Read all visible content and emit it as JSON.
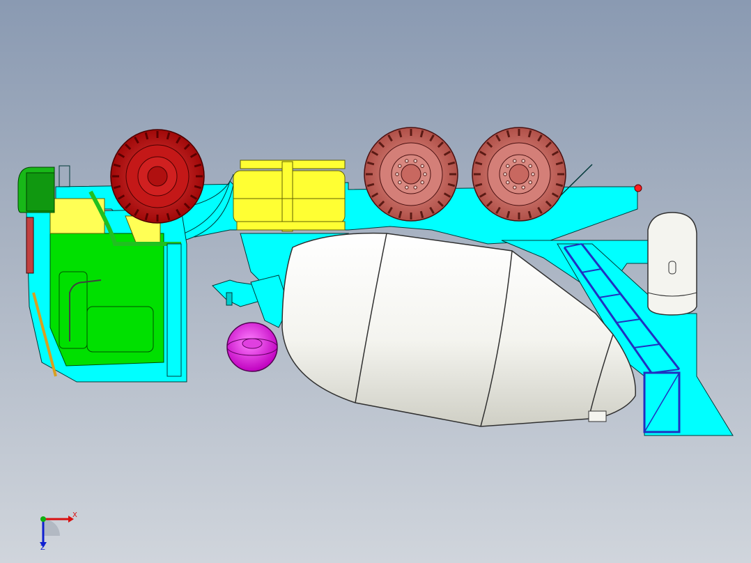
{
  "viewport": {
    "background_top": "#8a9ab2",
    "background_bottom": "#d0d5dc"
  },
  "model": {
    "parts": [
      {
        "name": "cab",
        "color": "#00e000"
      },
      {
        "name": "chassis-frame",
        "color": "#00ffff"
      },
      {
        "name": "front-wheel",
        "color": "#d01818"
      },
      {
        "name": "rear-wheels",
        "color": "#d87870"
      },
      {
        "name": "fuel-tank",
        "color": "#ffff33"
      },
      {
        "name": "mixer-drum",
        "color": "#f4f4ef"
      },
      {
        "name": "water-tank",
        "color": "#f4f4ef"
      },
      {
        "name": "ladder",
        "color": "#2030c0"
      },
      {
        "name": "spare-tire",
        "color": "#e020e0"
      },
      {
        "name": "air-intake",
        "color": "#109810"
      }
    ]
  },
  "triad": {
    "x_label": "X",
    "z_label": "Z",
    "x_color": "#d81010",
    "y_color": "#10b010",
    "z_color": "#1020d0"
  }
}
